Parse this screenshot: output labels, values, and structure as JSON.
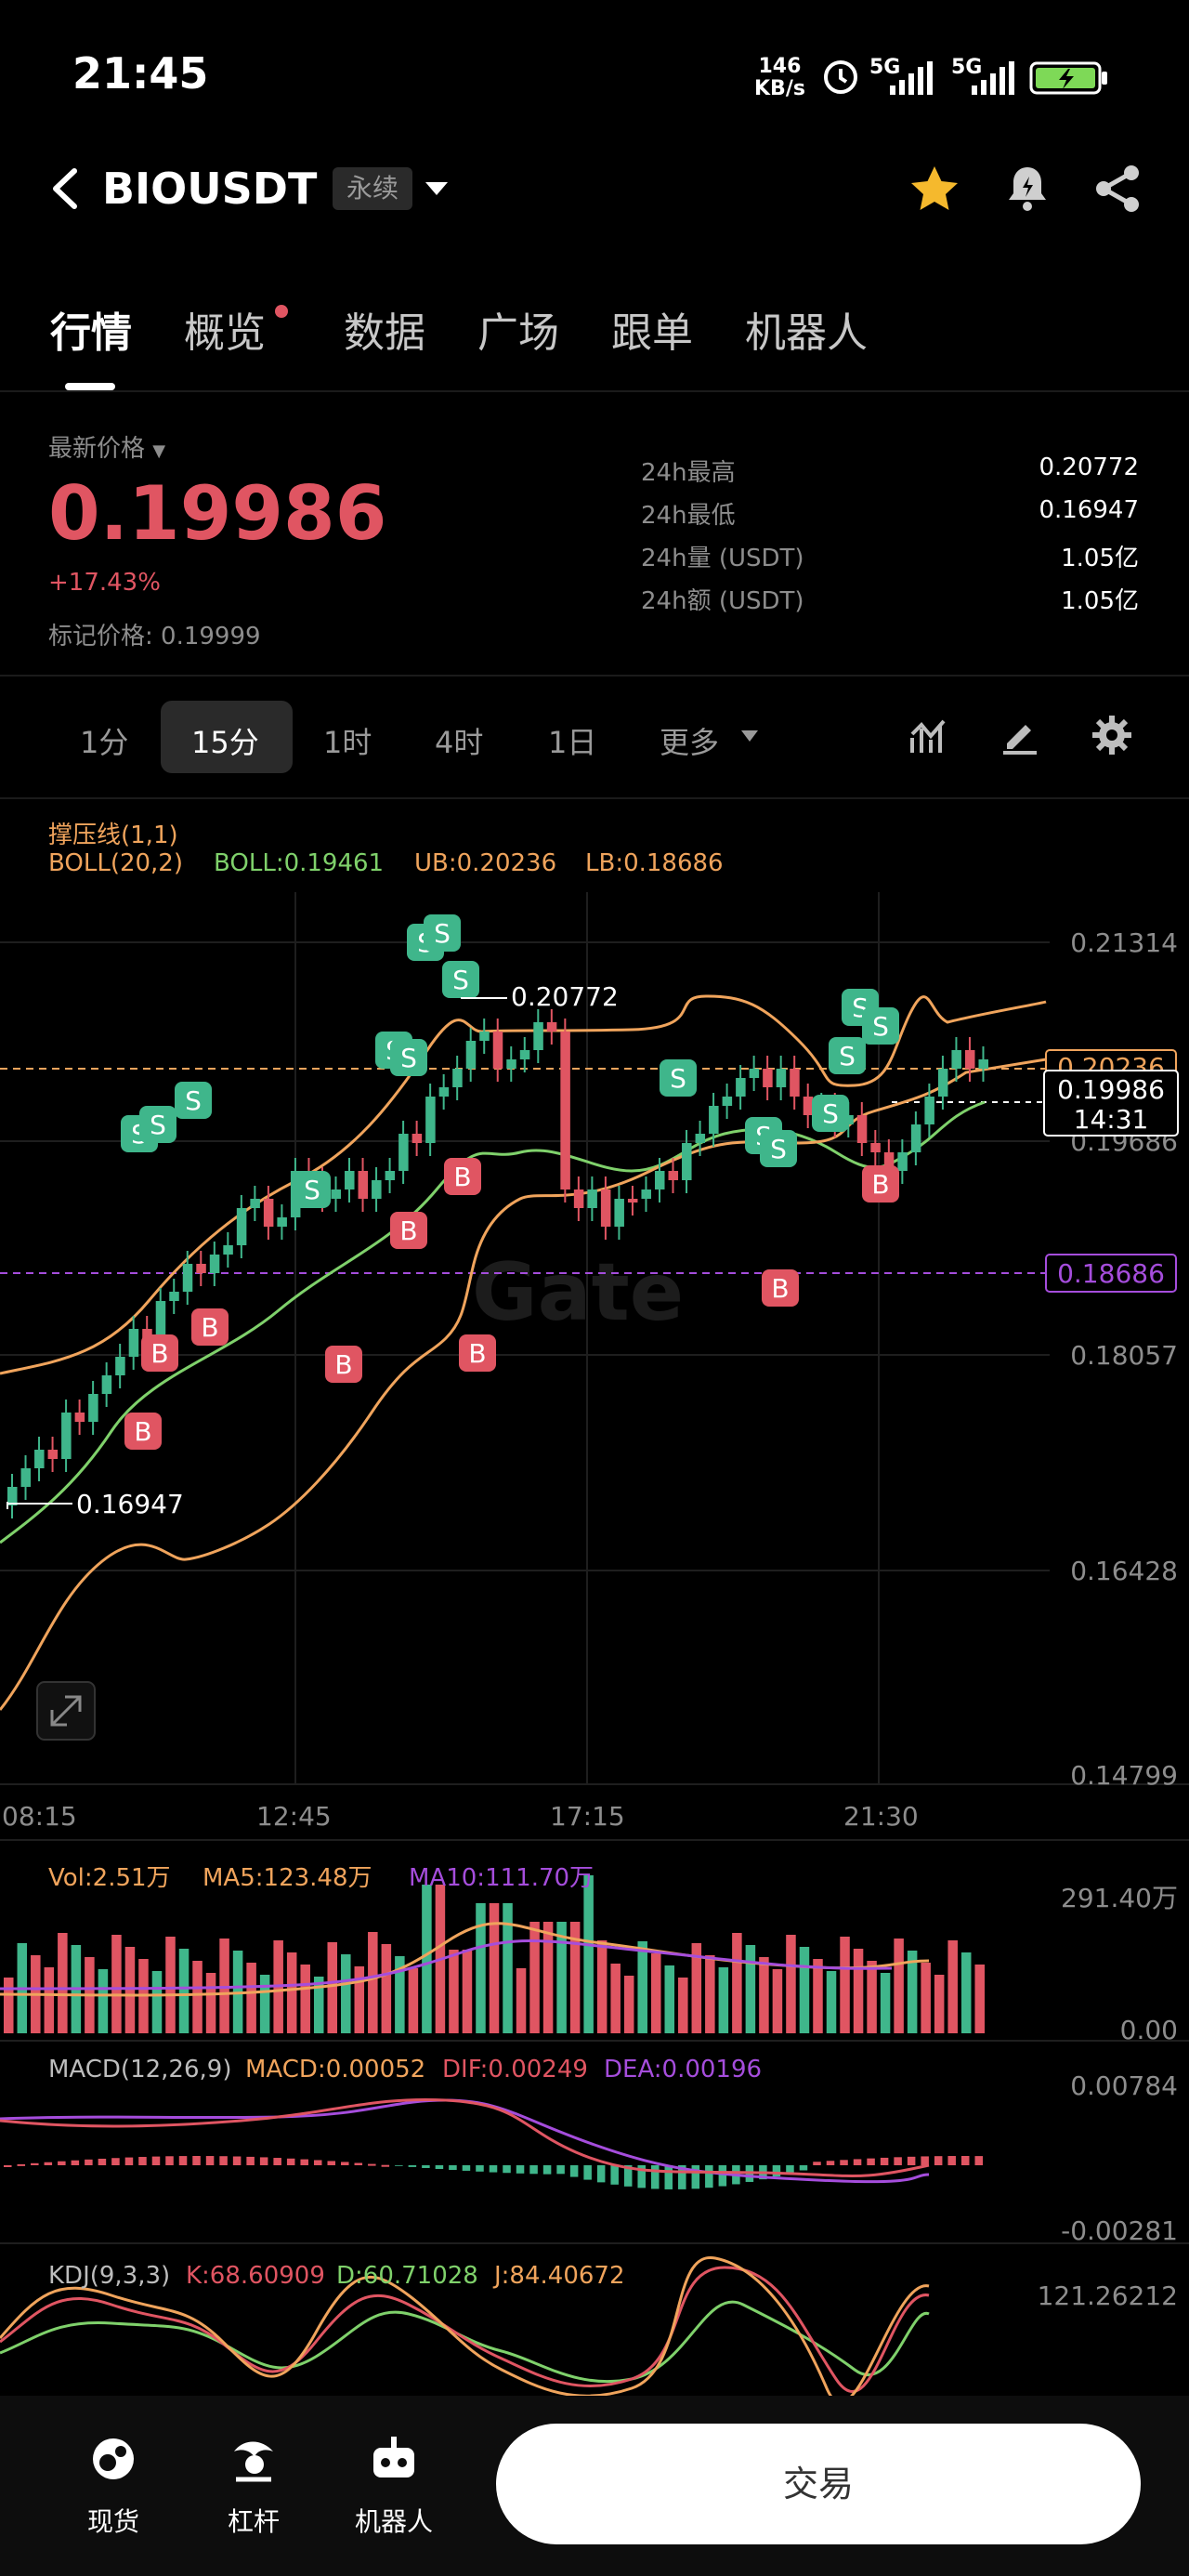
{
  "status_bar": {
    "time": "21:45",
    "net_speed_top": "146",
    "net_speed_bottom": "KB/s",
    "signal1": "5G",
    "signal2": "5G"
  },
  "header": {
    "symbol": "BIOUSDT",
    "contract_type": "永续"
  },
  "tabs": [
    {
      "label": "行情",
      "active": true
    },
    {
      "label": "概览",
      "dot": true
    },
    {
      "label": "数据"
    },
    {
      "label": "广场"
    },
    {
      "label": "跟单"
    },
    {
      "label": "机器人"
    }
  ],
  "ticker": {
    "last_price_label": "最新价格",
    "last_price": "0.19986",
    "change": "+17.43%",
    "mark_label": "标记价格:",
    "mark_price": "0.19999",
    "stats": [
      {
        "label": "24h最高",
        "value": "0.20772"
      },
      {
        "label": "24h最低",
        "value": "0.16947"
      },
      {
        "label": "24h量 (USDT)",
        "value": "1.05亿"
      },
      {
        "label": "24h额 (USDT)",
        "value": "1.05亿"
      }
    ]
  },
  "intervals": [
    "1分",
    "15分",
    "1时",
    "4时",
    "1日",
    "更多"
  ],
  "active_interval": "15分",
  "chart": {
    "indicator1": "撑压线(1,1)",
    "boll_name": "BOLL(20,2)",
    "boll_mid": "BOLL:0.19461",
    "boll_ub": "UB:0.20236",
    "boll_lb": "LB:0.18686",
    "y_labels": [
      "0.21314",
      "0.19686",
      "0.18057",
      "0.16428",
      "0.14799"
    ],
    "ub_tag": "0.20236",
    "lb_tag": "0.18686",
    "current_price_tag": "0.19986",
    "countdown": "14:31",
    "high_label": "0.20772",
    "low_label": "0.16947",
    "x_labels": [
      "08:15",
      "12:45",
      "17:15",
      "21:30"
    ],
    "watermark": "Gate",
    "buy_marker": "B",
    "sell_marker": "S",
    "colors": {
      "up": "#3fb68b",
      "down": "#e05562",
      "ub": "#f0a45c",
      "mid": "#7fd16b",
      "lb": "#f0a45c",
      "purple": "#a54ddc"
    }
  },
  "volume": {
    "vol": "Vol:2.51万",
    "ma5": "MA5:123.48万",
    "ma10": "MA10:111.70万",
    "y_top": "291.40万",
    "y_bottom": "0.00"
  },
  "macd": {
    "name": "MACD(12,26,9)",
    "macd": "MACD:0.00052",
    "dif": "DIF:0.00249",
    "dea": "DEA:0.00196",
    "y_top": "0.00784",
    "y_bottom": "-0.00281"
  },
  "kdj": {
    "name": "KDJ(9,3,3)",
    "k": "K:68.60909",
    "d": "D:60.71028",
    "j": "J:84.40672",
    "y_top": "121.26212"
  },
  "bottom_nav": [
    {
      "label": "现货",
      "icon": "spot-icon"
    },
    {
      "label": "杠杆",
      "icon": "leverage-icon"
    },
    {
      "label": "机器人",
      "icon": "robot-icon"
    }
  ],
  "trade_button": "交易"
}
